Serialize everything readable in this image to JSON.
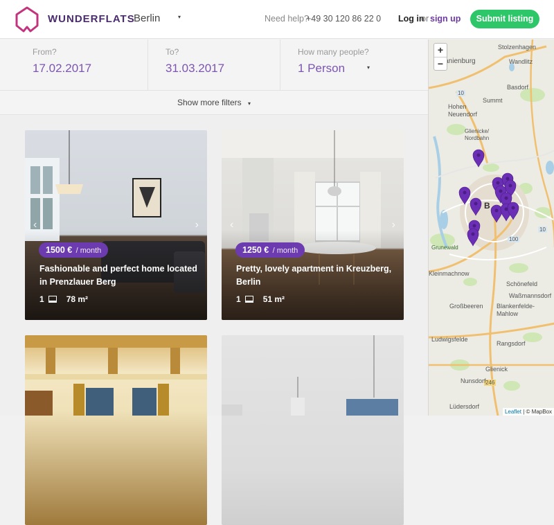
{
  "header": {
    "brand": "WUNDERFLATS",
    "city": "Berlin",
    "help_text": "Need help?",
    "phone": "+49 30 120 86 22 0",
    "login": "Log in",
    "or": "or",
    "signup": "sign up",
    "submit": "Submit listing",
    "caret": "▾"
  },
  "filters": {
    "from_label": "From?",
    "from_value": "17.02.2017",
    "to_label": "To?",
    "to_value": "31.03.2017",
    "people_label": "How many people?",
    "people_value": "1 Person",
    "more_filters": "Show more filters",
    "caret": "▾"
  },
  "listings": [
    {
      "price": "1500 €",
      "per": "/ month",
      "title": "Fashionable and perfect home located in Prenzlauer Berg",
      "beds": "1",
      "size": "78 m²"
    },
    {
      "price": "1250 €",
      "per": "/ month",
      "title": "Pretty, lovely apartment in Kreuzberg, Berlin",
      "beds": "1",
      "size": "51 m²"
    }
  ],
  "card_arrows": {
    "prev": "‹",
    "next": "›"
  },
  "map": {
    "zoom_in": "+",
    "zoom_out": "−",
    "labels": [
      "Stolzenhagen",
      "Wandlitz",
      "Oranienburg",
      "Basdorf",
      "Summt",
      "Hohen Neuendorf",
      "Glienicke/ Nordbahn",
      "Grunewald",
      "Kleinmachnow",
      "Schönefeld",
      "Waßmannsdorf",
      "Blankenfelde-Mahlow",
      "Großbeeren",
      "Ludwigsfelde",
      "Rangsdorf",
      "Glienick",
      "Nunsdorf",
      "Lüdersdorf",
      "B"
    ],
    "road_numbers": [
      "10",
      "10",
      "100",
      "246"
    ],
    "attribution_leaflet": "Leaflet",
    "attribution_sep": "|",
    "attribution_mapbox": "© MapBox",
    "pin_color": "#6a2fb5"
  }
}
